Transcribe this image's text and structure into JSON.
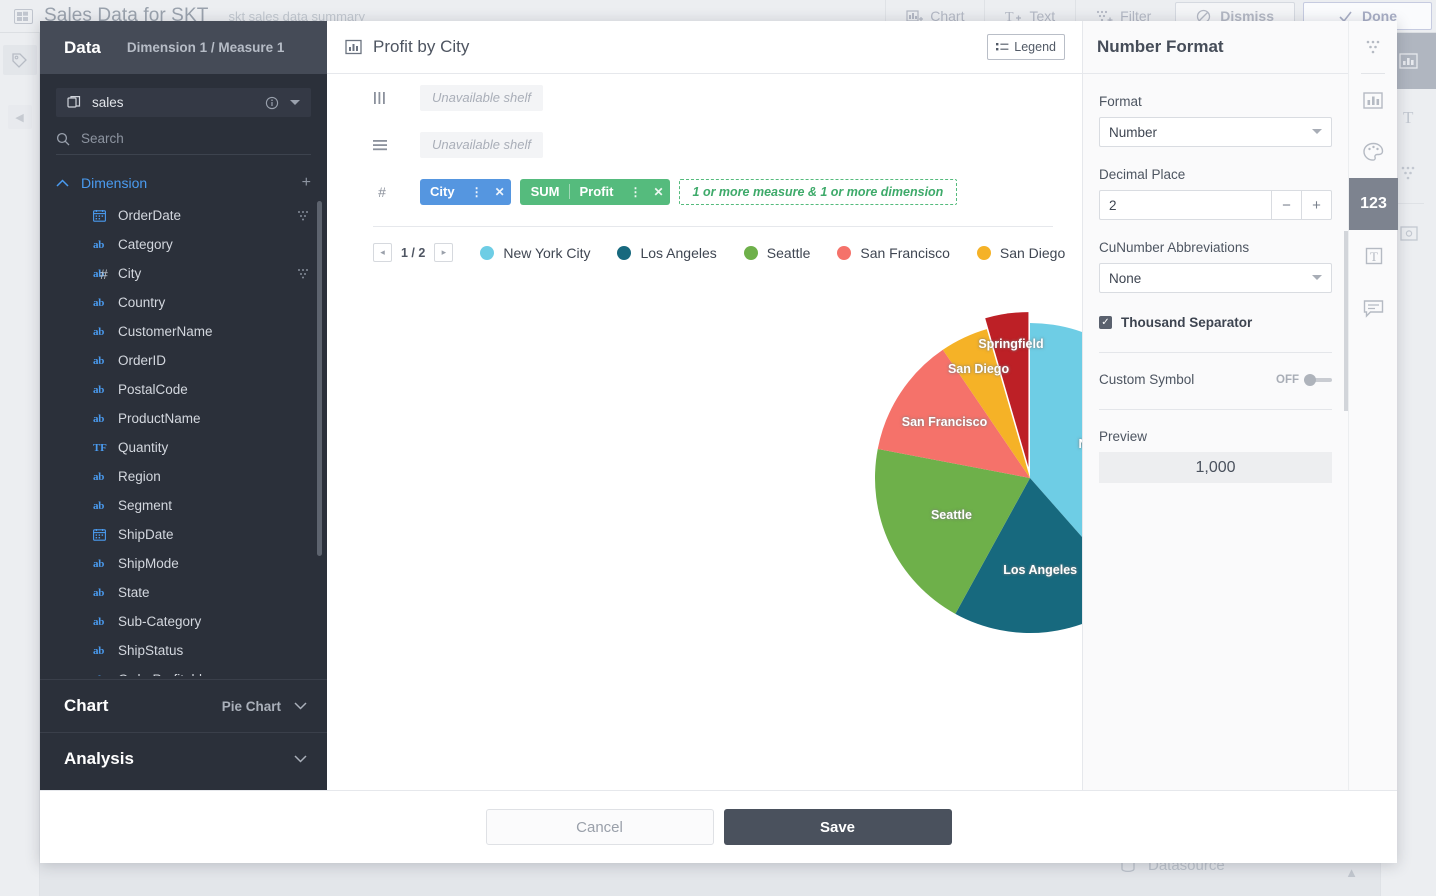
{
  "background": {
    "title": "Sales Data for SKT",
    "subtitle": "skt sales data summary",
    "actions": [
      {
        "label": "Chart",
        "icon": "chart-add-icon"
      },
      {
        "label": "Text",
        "icon": "text-add-icon"
      },
      {
        "label": "Filter",
        "icon": "filter-add-icon"
      },
      {
        "label": "Dismiss",
        "icon": "dismiss-icon"
      },
      {
        "label": "Done",
        "icon": "check-icon"
      }
    ],
    "datasource_label": "Datasource"
  },
  "sidebar": {
    "title": "Data",
    "subtitle": "Dimension 1 / Measure 1",
    "datasource": "sales",
    "search": {
      "value": "",
      "placeholder": "Search"
    },
    "dimension_label": "Dimension",
    "fields": [
      {
        "name": "OrderDate",
        "type": "date",
        "type_label": "",
        "has_dots": true,
        "has_hash": false
      },
      {
        "name": "Category",
        "type": "text",
        "type_label": "ab",
        "has_dots": false,
        "has_hash": false
      },
      {
        "name": "City",
        "type": "text",
        "type_label": "ab",
        "has_dots": true,
        "has_hash": true
      },
      {
        "name": "Country",
        "type": "text",
        "type_label": "ab",
        "has_dots": false,
        "has_hash": false
      },
      {
        "name": "CustomerName",
        "type": "text",
        "type_label": "ab",
        "has_dots": false,
        "has_hash": false
      },
      {
        "name": "OrderID",
        "type": "text",
        "type_label": "ab",
        "has_dots": false,
        "has_hash": false
      },
      {
        "name": "PostalCode",
        "type": "text",
        "type_label": "ab",
        "has_dots": false,
        "has_hash": false
      },
      {
        "name": "ProductName",
        "type": "text",
        "type_label": "ab",
        "has_dots": false,
        "has_hash": false
      },
      {
        "name": "Quantity",
        "type": "tf",
        "type_label": "TF",
        "has_dots": false,
        "has_hash": false
      },
      {
        "name": "Region",
        "type": "text",
        "type_label": "ab",
        "has_dots": false,
        "has_hash": false
      },
      {
        "name": "Segment",
        "type": "text",
        "type_label": "ab",
        "has_dots": false,
        "has_hash": false
      },
      {
        "name": "ShipDate",
        "type": "date",
        "type_label": "",
        "has_dots": false,
        "has_hash": false
      },
      {
        "name": "ShipMode",
        "type": "text",
        "type_label": "ab",
        "has_dots": false,
        "has_hash": false
      },
      {
        "name": "State",
        "type": "text",
        "type_label": "ab",
        "has_dots": false,
        "has_hash": false
      },
      {
        "name": "Sub-Category",
        "type": "text",
        "type_label": "ab",
        "has_dots": false,
        "has_hash": false
      },
      {
        "name": "ShipStatus",
        "type": "text",
        "type_label": "ab",
        "has_dots": false,
        "has_hash": false
      },
      {
        "name": "OrderProfitable",
        "type": "text",
        "type_label": "ab",
        "has_dots": false,
        "has_hash": false
      }
    ],
    "chart_section": {
      "title": "Chart",
      "value": "Pie Chart"
    },
    "analysis_section": {
      "title": "Analysis"
    }
  },
  "chart_panel": {
    "title": "Profit by City",
    "legend_button": "Legend",
    "shelves": [
      {
        "icon": "columns-icon",
        "placeholder": "Unavailable  shelf",
        "pills": []
      },
      {
        "icon": "rows-icon",
        "placeholder": "Unavailable  shelf",
        "pills": []
      }
    ],
    "measure_shelf": {
      "icon": "hash-icon",
      "pills": [
        {
          "label": "City",
          "agg": "",
          "color": "#5596e0"
        },
        {
          "label": "Profit",
          "agg": "SUM",
          "color": "#55bb7d"
        }
      ],
      "drop_hint": "1 or more measure & 1 or more dimension"
    },
    "pagination": {
      "current": "1 / 2",
      "prev": "◂",
      "next": "▸"
    }
  },
  "chart_data": {
    "type": "pie",
    "title": "Profit by City",
    "legend_position": "top",
    "categories": [
      "New York City",
      "Los Angeles",
      "Seattle",
      "San Francisco",
      "San Diego",
      "Springfield"
    ],
    "values": [
      38.5,
      19.5,
      20.0,
      12.5,
      5.0,
      4.5
    ],
    "colors": [
      "#6ecde5",
      "#17697e",
      "#6eb04a",
      "#f5726a",
      "#f5b227",
      "#bd2026"
    ],
    "labels_on_slices": [
      "New York City",
      "Los Angeles",
      "Seattle",
      "San Francisco",
      "San Diego",
      "Springfield"
    ],
    "legend_entries": [
      "New York City",
      "Los Angeles",
      "Seattle",
      "San Francisco",
      "San Diego"
    ],
    "exploded_slices": [
      "Springfield"
    ],
    "xlabel": "",
    "ylabel": ""
  },
  "number_format": {
    "title": "Number Format",
    "format_label": "Format",
    "format_value": "Number",
    "decimal_label": "Decimal Place",
    "decimal_value": "2",
    "decimal_minus": "−",
    "decimal_plus": "+",
    "abbrev_label": "CuNumber Abbreviations",
    "abbrev_value": "None",
    "thousand_label": "Thousand Separator",
    "thousand_checked": "✓",
    "custom_symbol_label": "Custom Symbol",
    "custom_symbol_state": "OFF",
    "preview_label": "Preview",
    "preview_value": "1,000"
  },
  "rail": {
    "items": [
      {
        "icon": "filter-dots-icon",
        "active": false
      },
      {
        "icon": "bar-chart-icon",
        "active": false
      },
      {
        "icon": "palette-icon",
        "active": false
      },
      {
        "icon": "number-format-icon",
        "label": "123",
        "active": true
      },
      {
        "icon": "text-box-icon",
        "active": false
      },
      {
        "icon": "comment-icon",
        "active": false
      }
    ]
  },
  "footer": {
    "cancel": "Cancel",
    "save": "Save"
  }
}
